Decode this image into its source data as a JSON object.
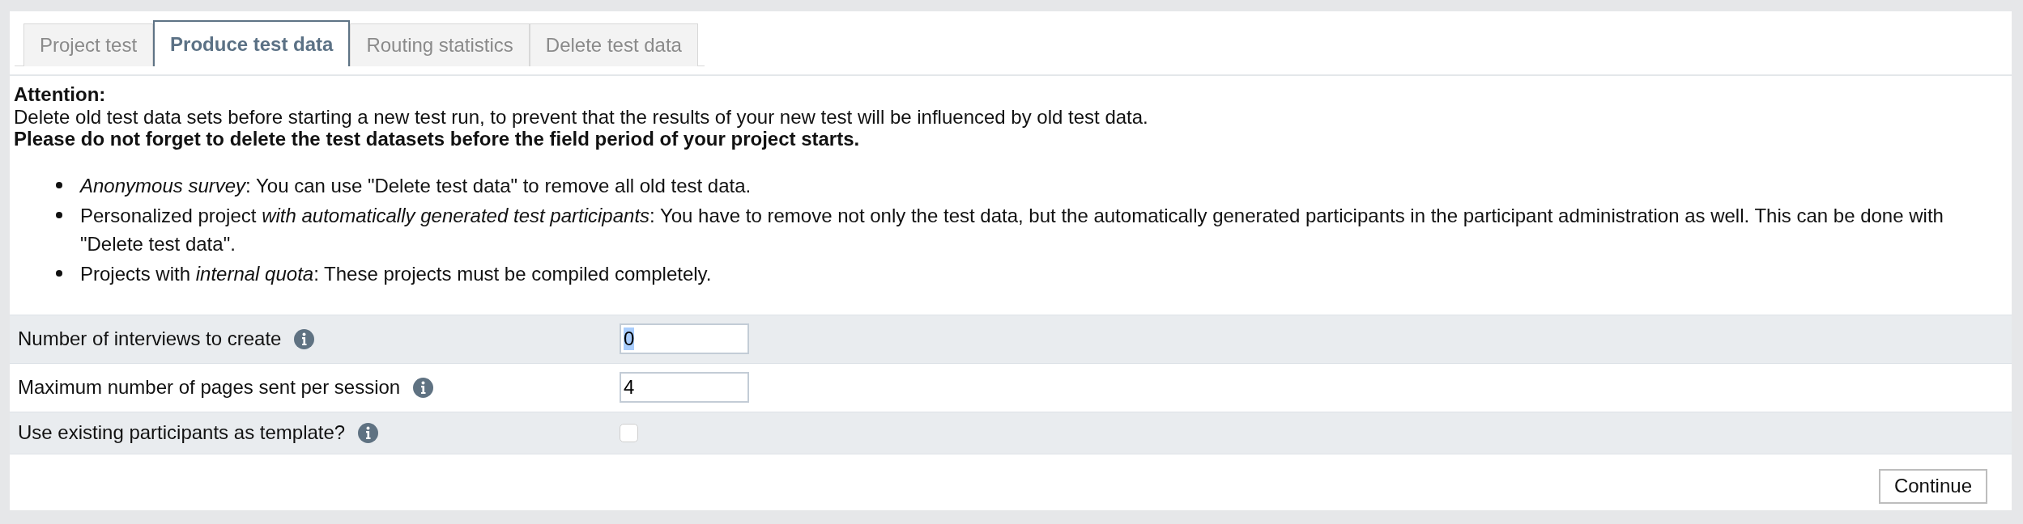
{
  "tabs": [
    {
      "label": "Project test",
      "selected": false
    },
    {
      "label": "Produce test data",
      "selected": true
    },
    {
      "label": "Routing statistics",
      "selected": false
    },
    {
      "label": "Delete test data",
      "selected": false
    }
  ],
  "notice": {
    "heading": "Attention:",
    "text": "Delete old test data sets before starting a new test run, to prevent that the results of your new test will be influenced by old test data.",
    "warning": "Please do not forget to delete the test datasets before the field period of your project starts.",
    "items": [
      "*Anonymous survey*: You can use \"Delete test data\" to remove all old test data.",
      "Personalized project *with automatically generated test participants*: You have to remove not only the test data, but the automatically generated participants in the participant administration as well. This can be done with \"Delete test data\".",
      "Projects with *internal quota*: These projects must be compiled completely."
    ]
  },
  "form": {
    "fields": [
      {
        "kind": "number",
        "label": "Number of interviews to create",
        "value": "0",
        "value_selected": true
      },
      {
        "kind": "number",
        "label": "Maximum number of pages sent per session",
        "value": "4",
        "value_selected": false
      },
      {
        "kind": "checkbox",
        "label": "Use existing participants as template?",
        "checked": false
      }
    ]
  },
  "buttons": [
    {
      "label": "Continue"
    }
  ]
}
